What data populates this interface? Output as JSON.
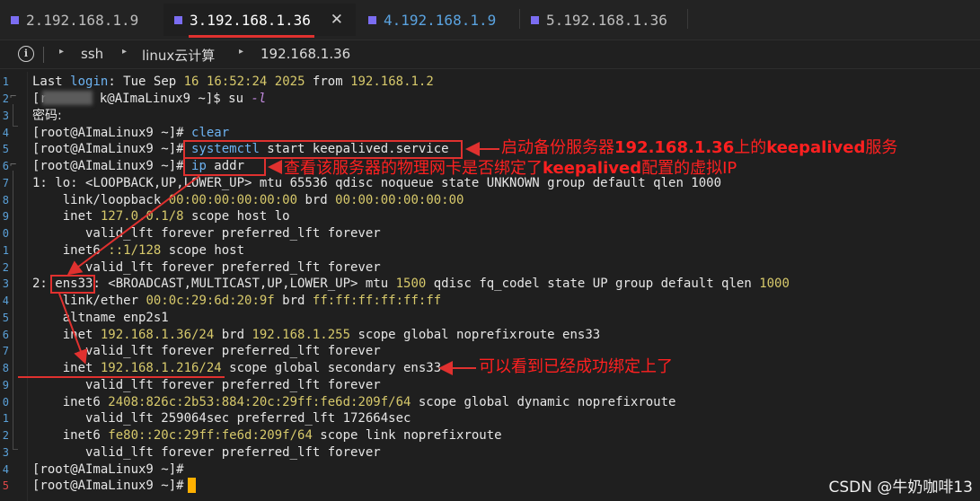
{
  "tabs": [
    {
      "label": "2.192.168.1.9",
      "active": false
    },
    {
      "label": "3.192.168.1.36",
      "active": true
    },
    {
      "label": "4.192.168.1.9",
      "active": false
    },
    {
      "label": "5.192.168.1.36",
      "active": false
    }
  ],
  "tab_close_glyph": "✕",
  "breadcrumb": [
    "ssh",
    "linux云计算",
    "192.168.1.36"
  ],
  "terminal": {
    "l1a": "Last ",
    "l1b": "login",
    "l1c": ": Tue Sep ",
    "l1d": "16 16",
    "l1e": ":52:24 ",
    "l1f": "2025",
    "l1g": " from ",
    "l1h": "192.168.1.2",
    "l2a": "[r",
    "l2b": "k@AImaLinux9 ~]$ su ",
    "l2c": "-l",
    "l3": "密码:",
    "l4a": "[root@AImaLinux9 ~]# ",
    "l4b": "clear",
    "l5a": "[root@AImaLinux9 ~]# ",
    "l5b": "systemctl",
    "l5c": " start keepalived.service",
    "l6a": "[root@AImaLinux9 ~]# ",
    "l6b": "ip",
    "l6c": " addr",
    "l7": "1: lo: <LOOPBACK,UP,LOWER_UP> mtu 65536 qdisc noqueue state UNKNOWN group default qlen 1000",
    "l8a": "    link/loopback ",
    "l8b": "00:00:00:00:00:00",
    "l8c": " brd ",
    "l8d": "00:00:00:00:00:00",
    "l9a": "    inet ",
    "l9b": "127.0.0.1/8",
    "l9c": " scope host lo",
    "l10": "       valid_lft forever preferred_lft forever",
    "l11a": "    inet6 ",
    "l11b": "::1/128",
    "l11c": " scope host",
    "l12": "       valid_lft forever preferred_lft forever",
    "l13a": "2: ",
    "l13b": "ens33",
    "l13c": ": <BROADCAST,MULTICAST,UP,LOWER_UP> mtu ",
    "l13d": "1500",
    "l13e": " qdisc fq_codel state UP group default qlen ",
    "l13f": "1000",
    "l14a": "    link/ether ",
    "l14b": "00:0c:29:6d:20:9f",
    "l14c": " brd ",
    "l14d": "ff:ff:ff:ff:ff:ff",
    "l15": "    altname enp2s1",
    "l16a": "    inet ",
    "l16b": "192.168.1.36/24",
    "l16c": " brd ",
    "l16d": "192.168.1.255",
    "l16e": " scope global noprefixroute ens33",
    "l17": "       valid_lft forever preferred_lft forever",
    "l18a": "    inet ",
    "l18b": "192.168.1.216/24",
    "l18c": " scope global secondary ens33",
    "l19": "       valid_lft forever preferred_lft forever",
    "l20a": "    inet6 ",
    "l20b": "2408:826c:2b53:884:20c:29ff:fe6d:209f/64",
    "l20c": " scope global dynamic noprefixroute",
    "l21": "       valid_lft 259064sec preferred_lft 172664sec",
    "l22a": "    inet6 ",
    "l22b": "fe80::20c:29ff:fe6d:209f/64",
    "l22c": " scope link noprefixroute",
    "l23": "       valid_lft forever preferred_lft forever",
    "l24": "[root@AImaLinux9 ~]#",
    "l25": "[root@AImaLinux9 ~]#"
  },
  "line_numbers": [
    "1",
    "2",
    "3",
    "4",
    "5",
    "6",
    "7",
    "8",
    "9",
    "0",
    "1",
    "2",
    "3",
    "4",
    "5",
    "6",
    "7",
    "8",
    "9",
    "0",
    "1",
    "2",
    "3",
    "4",
    "5"
  ],
  "annotations": {
    "a1_pre": "启动备份服务器",
    "a1_bold": "192.168.1.36",
    "a1_mid": "上的",
    "a1_bold2": "keepalived",
    "a1_post": "服务",
    "a2_pre": "查看该服务器的物理网卡是否绑定了",
    "a2_bold": "keepalived",
    "a2_post": "配置的虚拟IP",
    "a3": "可以看到已经成功绑定上了"
  },
  "watermark": "CSDN @牛奶咖啡13",
  "colors": {
    "accent": "#e0312f",
    "tab_marker": "#7b6df2",
    "cursor": "#ffb000"
  }
}
